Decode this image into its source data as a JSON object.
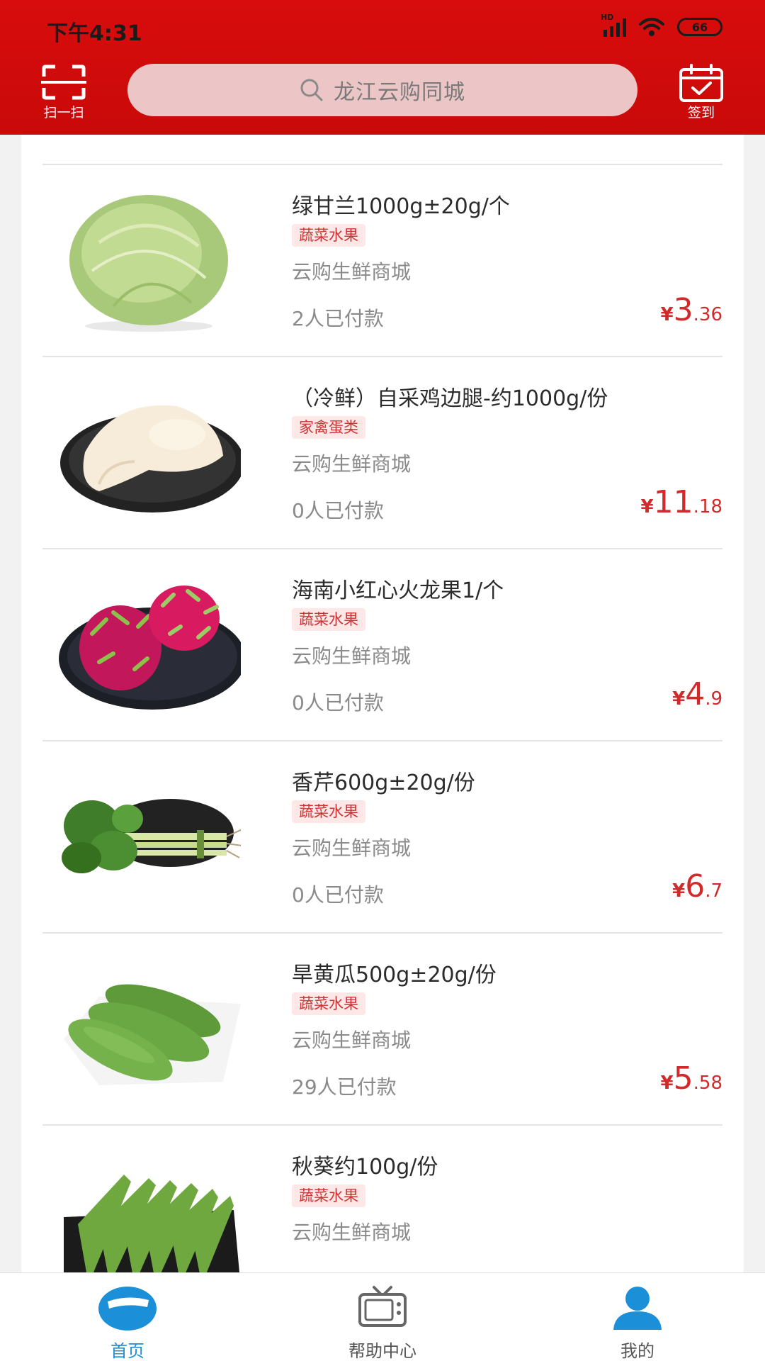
{
  "status_bar": {
    "time": "下午4:31",
    "signal_label": "HD",
    "battery": "66"
  },
  "header": {
    "scan_label": "扫一扫",
    "search_placeholder": "龙江云购同城",
    "signin_label": "签到"
  },
  "products": [
    {
      "title": "绿甘兰1000g±20g/个",
      "tag": "蔬菜水果",
      "shop": "云购生鲜商城",
      "paid": "2人已付款",
      "price_currency": "¥",
      "price_int": "3",
      "price_dec": ".36",
      "image": "cabbage"
    },
    {
      "title": "（冷鲜）自采鸡边腿-约1000g/份",
      "tag": "家禽蛋类",
      "shop": "云购生鲜商城",
      "paid": "0人已付款",
      "price_currency": "¥",
      "price_int": "11",
      "price_dec": ".18",
      "image": "chicken-leg"
    },
    {
      "title": "海南小红心火龙果1/个",
      "tag": "蔬菜水果",
      "shop": "云购生鲜商城",
      "paid": "0人已付款",
      "price_currency": "¥",
      "price_int": "4",
      "price_dec": ".9",
      "image": "dragon-fruit"
    },
    {
      "title": "香芹600g±20g/份",
      "tag": "蔬菜水果",
      "shop": "云购生鲜商城",
      "paid": "0人已付款",
      "price_currency": "¥",
      "price_int": "6",
      "price_dec": ".7",
      "image": "celery"
    },
    {
      "title": "旱黄瓜500g±20g/份",
      "tag": "蔬菜水果",
      "shop": "云购生鲜商城",
      "paid": "29人已付款",
      "price_currency": "¥",
      "price_int": "5",
      "price_dec": ".58",
      "image": "cucumber"
    },
    {
      "title": "秋葵约100g/份",
      "tag": "蔬菜水果",
      "shop": "云购生鲜商城",
      "paid": "",
      "price_currency": "",
      "price_int": "",
      "price_dec": "",
      "image": "okra"
    }
  ],
  "bottom_nav": [
    {
      "label": "首页",
      "icon": "home-icon",
      "active": true
    },
    {
      "label": "帮助中心",
      "icon": "tv-icon",
      "active": false
    },
    {
      "label": "我的",
      "icon": "user-icon",
      "active": false
    }
  ],
  "colors": {
    "brand_red": "#d80c0c",
    "price_red": "#d22a2a",
    "active_blue": "#1b8fd8"
  }
}
